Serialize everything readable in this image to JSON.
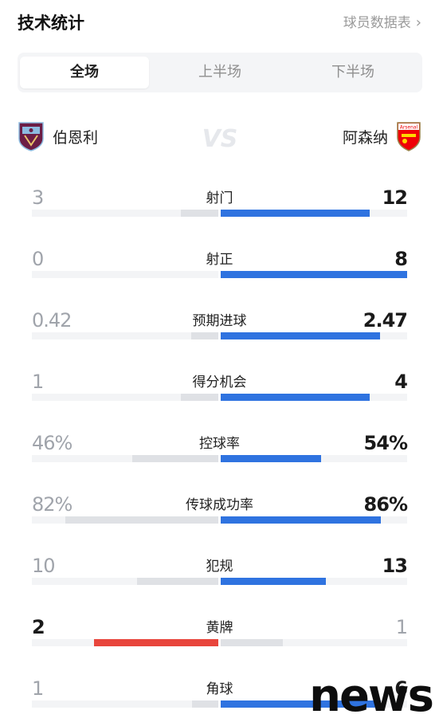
{
  "header": {
    "title": "技术统计",
    "player_link": "球员数据表",
    "chevron": "›"
  },
  "tabs": [
    {
      "label": "全场",
      "active": true
    },
    {
      "label": "上半场",
      "active": false
    },
    {
      "label": "下半场",
      "active": false
    }
  ],
  "teams": {
    "home": {
      "name": "伯恩利",
      "crest_icon": "burnley-crest-icon"
    },
    "away": {
      "name": "阿森纳",
      "crest_icon": "arsenal-crest-icon",
      "crest_text": "Arsenal"
    },
    "vs_icon": "vs-icon"
  },
  "colors": {
    "winner_fill": "#2f73e0",
    "loser_fill": "#dfe1e5",
    "yellow_leader_fill": "#e8453c",
    "track": "#f3f4f6",
    "leader_text": "#1a1a1a",
    "trailer_text": "#a0a4ab"
  },
  "stats": [
    {
      "name": "射门",
      "home": "3",
      "away": "12",
      "home_pct": 0.2,
      "away_pct": 0.8,
      "leader": "away",
      "home_fill": "#dfe1e5",
      "away_fill": "#2f73e0"
    },
    {
      "name": "射正",
      "home": "0",
      "away": "8",
      "home_pct": 0.0,
      "away_pct": 1.0,
      "leader": "away",
      "home_fill": "#dfe1e5",
      "away_fill": "#2f73e0"
    },
    {
      "name": "预期进球",
      "home": "0.42",
      "away": "2.47",
      "home_pct": 0.145,
      "away_pct": 0.855,
      "leader": "away",
      "home_fill": "#dfe1e5",
      "away_fill": "#2f73e0"
    },
    {
      "name": "得分机会",
      "home": "1",
      "away": "4",
      "home_pct": 0.2,
      "away_pct": 0.8,
      "leader": "away",
      "home_fill": "#dfe1e5",
      "away_fill": "#2f73e0"
    },
    {
      "name": "控球率",
      "home": "46%",
      "away": "54%",
      "home_pct": 0.46,
      "away_pct": 0.54,
      "leader": "away",
      "home_fill": "#dfe1e5",
      "away_fill": "#2f73e0"
    },
    {
      "name": "传球成功率",
      "home": "82%",
      "away": "86%",
      "home_pct": 0.82,
      "away_pct": 0.86,
      "leader": "away",
      "home_fill": "#dfe1e5",
      "away_fill": "#2f73e0"
    },
    {
      "name": "犯规",
      "home": "10",
      "away": "13",
      "home_pct": 0.435,
      "away_pct": 0.565,
      "leader": "away",
      "home_fill": "#dfe1e5",
      "away_fill": "#2f73e0"
    },
    {
      "name": "黄牌",
      "home": "2",
      "away": "1",
      "home_pct": 0.667,
      "away_pct": 0.333,
      "leader": "home",
      "home_fill": "#e8453c",
      "away_fill": "#dfe1e5"
    },
    {
      "name": "角球",
      "home": "1",
      "away": "6",
      "home_pct": 0.143,
      "away_pct": 0.857,
      "leader": "away",
      "home_fill": "#dfe1e5",
      "away_fill": "#2f73e0"
    }
  ],
  "watermark": "news"
}
